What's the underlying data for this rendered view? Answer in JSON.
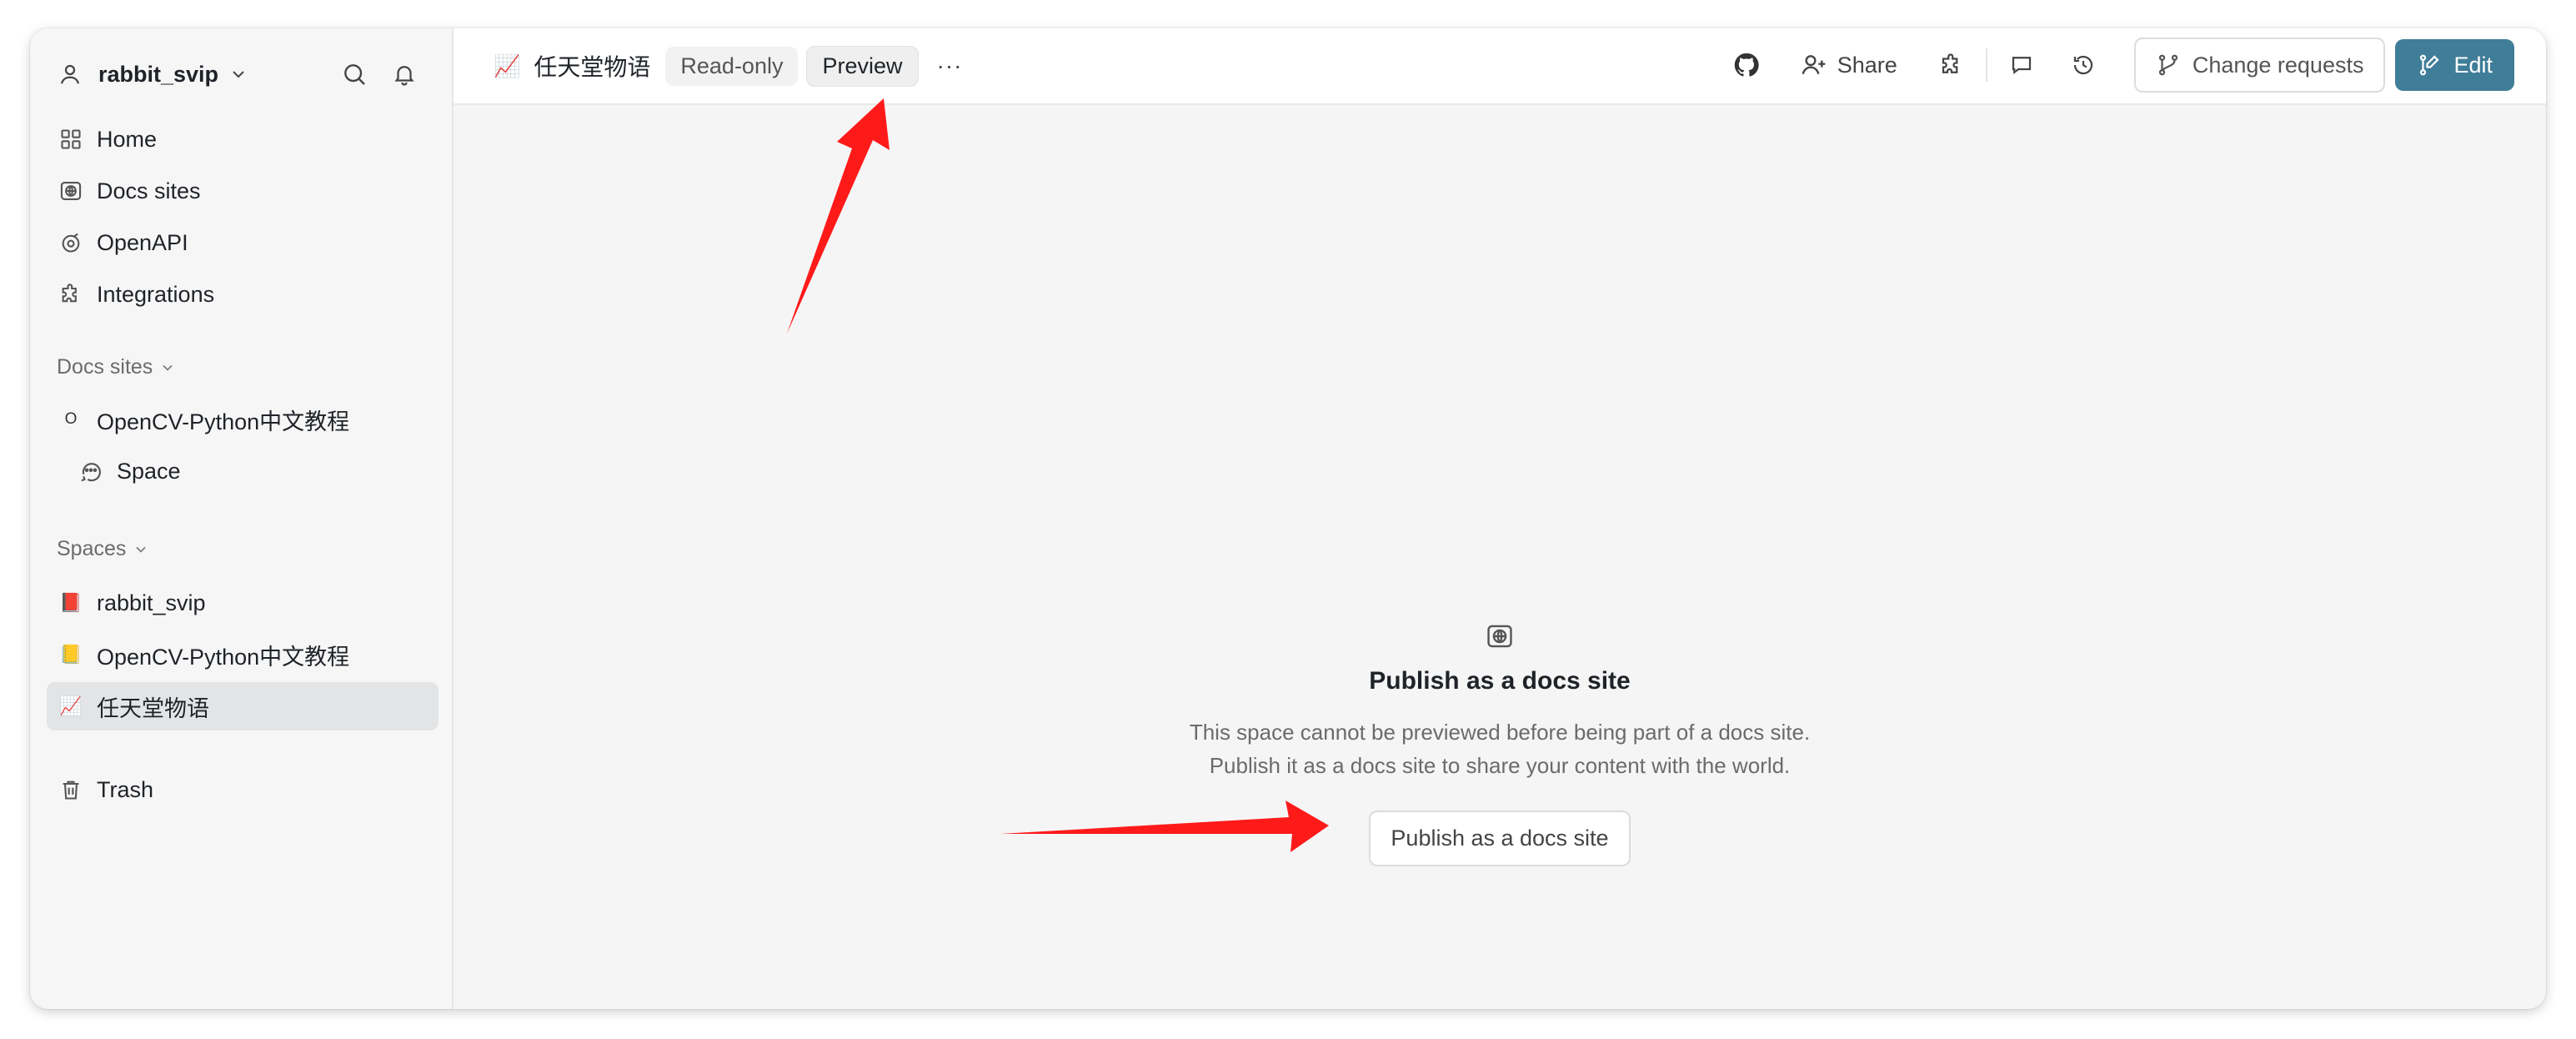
{
  "sidebar": {
    "org_name": "rabbit_svip",
    "nav": [
      {
        "label": "Home",
        "icon": "home-grid-icon"
      },
      {
        "label": "Docs sites",
        "icon": "globe-icon"
      },
      {
        "label": "OpenAPI",
        "icon": "openapi-icon"
      },
      {
        "label": "Integrations",
        "icon": "puzzle-icon"
      }
    ],
    "docs_sites_title": "Docs sites",
    "docs_sites": [
      {
        "label": "OpenCV-Python中文教程",
        "badge": "O"
      },
      {
        "label": "Space"
      }
    ],
    "spaces_title": "Spaces",
    "spaces": [
      {
        "label": "rabbit_svip",
        "emoji": "📕"
      },
      {
        "label": "OpenCV-Python中文教程",
        "emoji": "📒"
      },
      {
        "label": "任天堂物语",
        "emoji": "📈"
      }
    ],
    "trash_label": "Trash"
  },
  "topbar": {
    "space_emoji": "📈",
    "title": "任天堂物语",
    "readonly_label": "Read-only",
    "preview_label": "Preview",
    "more_label": "···",
    "share_label": "Share",
    "change_requests_label": "Change requests",
    "edit_label": "Edit"
  },
  "main": {
    "empty_title": "Publish as a docs site",
    "empty_desc_1": "This space cannot be previewed before being part of a docs site.",
    "empty_desc_2": "Publish it as a docs site to share your content with the world.",
    "publish_button": "Publish as a docs site"
  },
  "colors": {
    "accent": "#3f7d98",
    "arrow": "#ff1a1a"
  }
}
